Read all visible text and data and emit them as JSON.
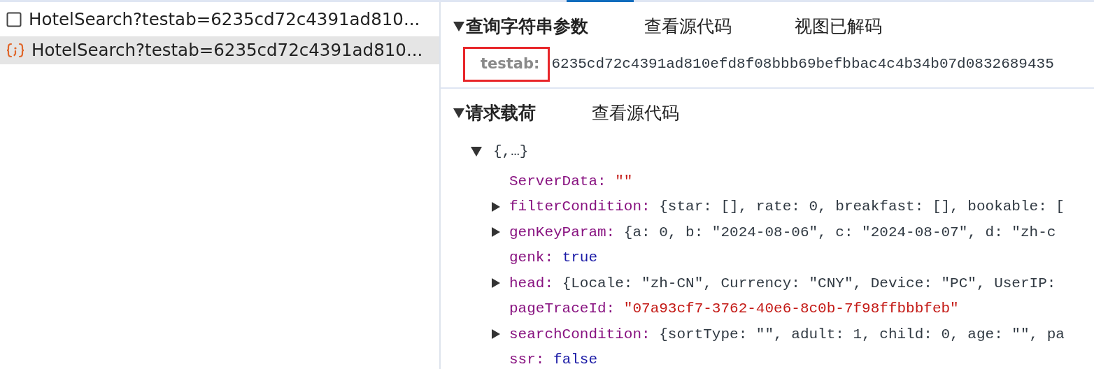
{
  "requests": [
    {
      "name": "HotelSearch?testab=6235cd72c4391ad810...",
      "kind": "document",
      "selected": false
    },
    {
      "name": "HotelSearch?testab=6235cd72c4391ad810...",
      "kind": "fetch",
      "selected": true
    }
  ],
  "query_section": {
    "title": "查询字符串参数",
    "expanded": true,
    "actions": [
      "查看源代码",
      "视图已解码"
    ],
    "params": [
      {
        "key": "testab:",
        "value": "6235cd72c4391ad810efd8f08bbb69befbbac4c4b34b07d0832689435",
        "highlighted": true
      }
    ]
  },
  "payload_section": {
    "title": "请求载荷",
    "expanded": true,
    "actions": [
      "查看源代码"
    ],
    "root": {
      "preview": "{,…}",
      "expanded": true
    },
    "properties": [
      {
        "key": "ServerData:",
        "value": "\"\"",
        "kind": "string",
        "expandable": false
      },
      {
        "key": "filterCondition:",
        "value": "{star: [], rate: 0, breakfast: [], bookable: [",
        "kind": "object",
        "expandable": true
      },
      {
        "key": "genKeyParam:",
        "value": "{a: 0, b: \"2024-08-06\", c: \"2024-08-07\", d: \"zh-c",
        "kind": "object",
        "expandable": true
      },
      {
        "key": "genk:",
        "value": "true",
        "kind": "boolean",
        "expandable": false
      },
      {
        "key": "head:",
        "value": "{Locale: \"zh-CN\", Currency: \"CNY\", Device: \"PC\", UserIP:",
        "kind": "object",
        "expandable": true
      },
      {
        "key": "pageTraceId:",
        "value": "\"07a93cf7-3762-40e6-8c0b-7f98ffbbbfeb\"",
        "kind": "string",
        "expandable": false
      },
      {
        "key": "searchCondition:",
        "value": "{sortType: \"\", adult: 1, child: 0, age: \"\", pa",
        "kind": "object",
        "expandable": true
      },
      {
        "key": "ssr:",
        "value": "false",
        "kind": "boolean",
        "expandable": false
      }
    ]
  }
}
